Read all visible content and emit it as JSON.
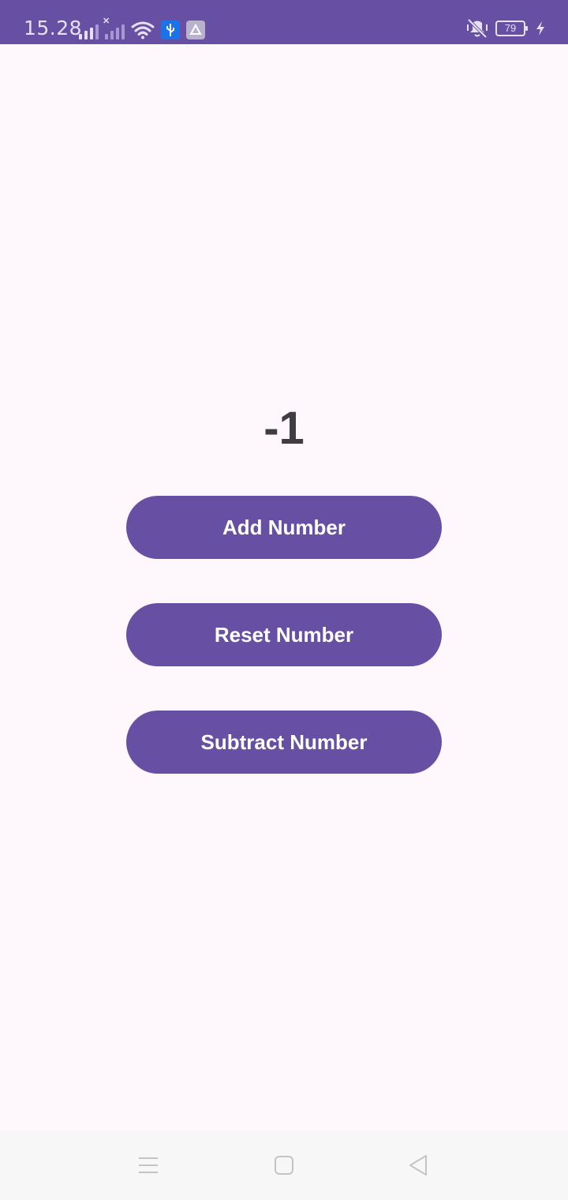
{
  "status_bar": {
    "time": "15.28",
    "battery_level": "79",
    "icons": [
      "signal-icon",
      "signal-no-service-icon",
      "wifi-icon",
      "usb-debug-icon",
      "notification-app-icon",
      "vibrate-off-icon",
      "battery-icon",
      "charging-icon"
    ],
    "bar_color": "#6750a4"
  },
  "counter": {
    "value": "-1"
  },
  "buttons": {
    "add_label": "Add Number",
    "reset_label": "Reset Number",
    "subtract_label": "Subtract Number",
    "color": "#6750a4"
  },
  "nav_bar": {
    "icons": [
      "menu-icon",
      "home-icon",
      "back-icon"
    ]
  }
}
